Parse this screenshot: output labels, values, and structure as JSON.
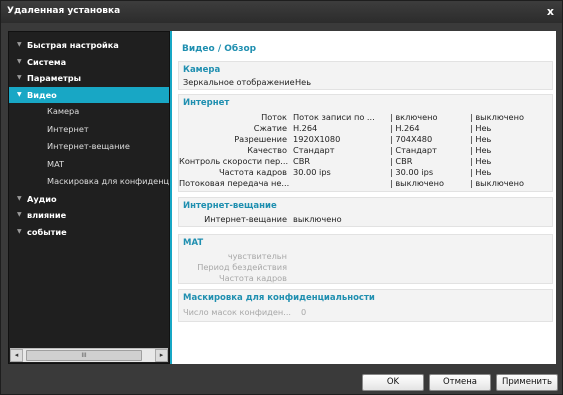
{
  "window": {
    "title": "Удаленная установка",
    "close_glyph": "x"
  },
  "sidebar": {
    "nodes": [
      {
        "label": "Быстрая настройка"
      },
      {
        "label": "Система"
      },
      {
        "label": "Параметры"
      },
      {
        "label": "Видео"
      },
      {
        "label": "Аудио"
      },
      {
        "label": "влияние"
      },
      {
        "label": "событие"
      }
    ],
    "video_children": [
      "Камера",
      "Интернет",
      "Интернет-вещание",
      "MAT",
      "Маскировка для конфиденци"
    ],
    "scroll": {
      "left": "◂",
      "right": "▸",
      "thumb": "III"
    }
  },
  "content": {
    "title": "Видео / Обзор",
    "camera": {
      "heading": "Камера",
      "mirror_label": "Зеркальное отображение",
      "mirror_value": "Неь"
    },
    "internet": {
      "heading": "Интернет",
      "rows": [
        {
          "label": "Поток",
          "c1": "Поток записи по ...",
          "c2": "| включено",
          "c3": "| выключено"
        },
        {
          "label": "Сжатие",
          "c1": "H.264",
          "c2": "| H.264",
          "c3": "| Неь"
        },
        {
          "label": "Разрешение",
          "c1": "1920X1080",
          "c2": "| 704X480",
          "c3": "| Неь"
        },
        {
          "label": "Качество",
          "c1": "Стандарт",
          "c2": "| Стандарт",
          "c3": "| Неь"
        },
        {
          "label": "Контроль скорости пер...",
          "c1": "CBR",
          "c2": "| CBR",
          "c3": "| Неь"
        },
        {
          "label": "Частота кадров",
          "c1": "30.00 ips",
          "c2": "| 30.00 ips",
          "c3": "| Неь"
        },
        {
          "label": "Потоковая передача не...",
          "c1": "",
          "c2": "| выключено",
          "c3": "| выключено"
        }
      ]
    },
    "broadcast": {
      "heading": "Интернет-вещание",
      "label": "Интернет-вещание",
      "value": "выключено"
    },
    "mat": {
      "heading": "MAT",
      "rows": [
        "чувствительн",
        "Период бездействия",
        "Частота кадров"
      ]
    },
    "privacy": {
      "heading": "Маскировка для конфиденциальности",
      "label": "Число масок конфиден...",
      "value": "0"
    }
  },
  "footer": {
    "ok": "OK",
    "cancel": "Отмена",
    "apply": "Применить"
  }
}
